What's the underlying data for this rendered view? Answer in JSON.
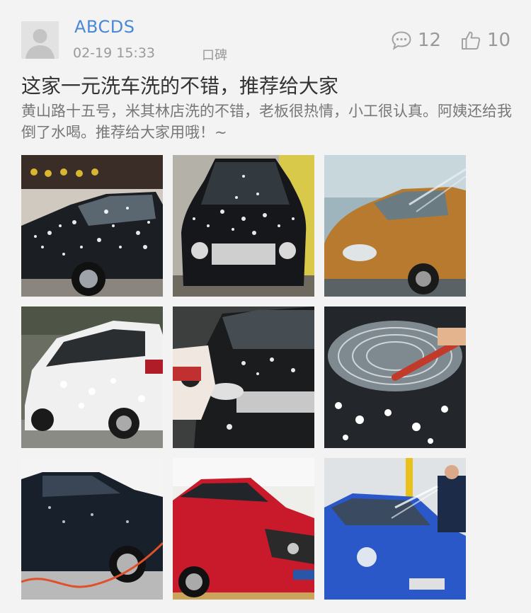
{
  "post": {
    "username": "ABCDS",
    "date": "02-19 15:33",
    "tag": "口碑",
    "comments_count": "12",
    "likes_count": "10",
    "title": "这家一元洗车洗的不错，推荐给大家",
    "body": "黄山路十五号，米其林店洗的不错，老板很热情，小工很认真。阿姨还给我倒了水喝。推荐给大家用哦！~"
  },
  "icons": {
    "avatar": "default-avatar-icon",
    "comments": "comment-bubble-icon",
    "likes": "thumbs-up-icon"
  },
  "colors": {
    "background": "#f3f3f3",
    "username": "#4a87d6",
    "meta": "#9a9a9a",
    "title": "#333333",
    "body": "#777777"
  },
  "photos": [
    {
      "subject": "black SUV covered in foam"
    },
    {
      "subject": "black luxury sedan front covered in foam"
    },
    {
      "subject": "orange SUV being rinsed"
    },
    {
      "subject": "white SUV covered in foam"
    },
    {
      "subject": "worker washing black sedan hood"
    },
    {
      "subject": "foam swirls on dark car hood"
    },
    {
      "subject": "dark blue SUV with orange hose"
    },
    {
      "subject": "red coupe in wash bay"
    },
    {
      "subject": "worker rinsing blue hatchback"
    }
  ]
}
